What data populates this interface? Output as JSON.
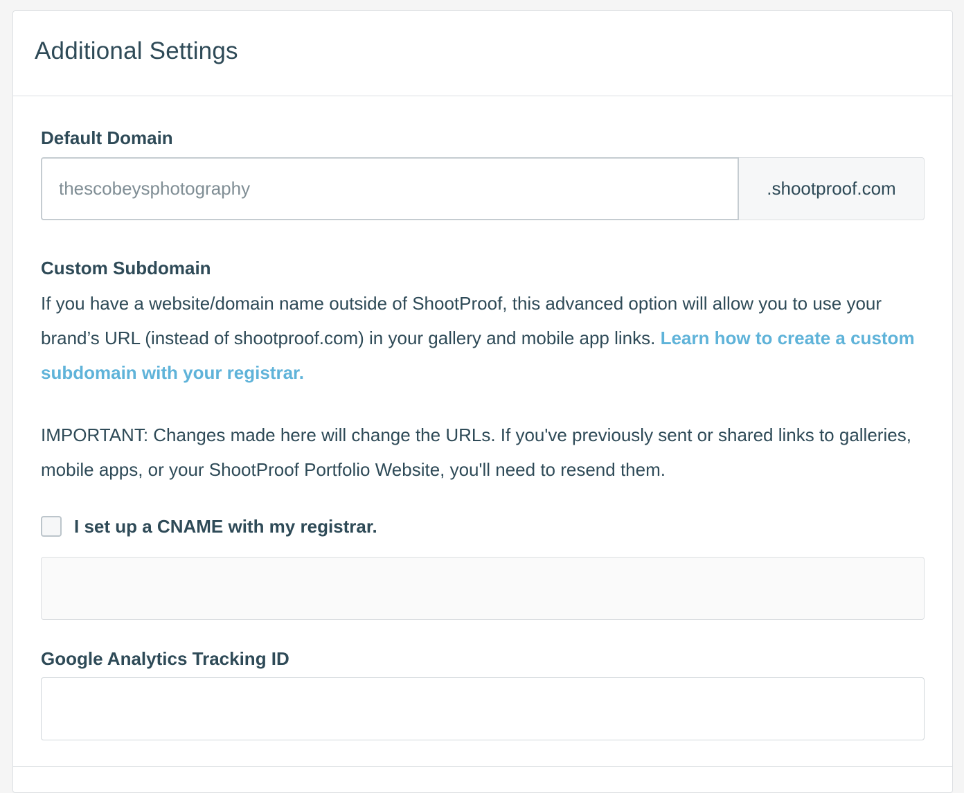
{
  "panel": {
    "title": "Additional Settings"
  },
  "default_domain": {
    "label": "Default Domain",
    "placeholder": "thescobeysphotography",
    "suffix": ".shootproof.com"
  },
  "custom_subdomain": {
    "label": "Custom Subdomain",
    "description": "If you have a website/domain name outside of ShootProof, this advanced option will allow you to use your brand’s URL (instead of shootproof.com) in your gallery and mobile app links. ",
    "learn_link": "Learn how to create a custom subdomain with your registrar.",
    "important": "IMPORTANT: Changes made here will change the URLs. If you've previously sent or shared links to galleries, mobile apps, or your ShootProof Portfolio Website, you'll need to resend them.",
    "cname_checkbox_label": "I set up a CNAME with my registrar.",
    "cname_checked": false,
    "subdomain_value": ""
  },
  "google_analytics": {
    "label": "Google Analytics Tracking ID",
    "value": ""
  },
  "colors": {
    "text": "#2e4a57",
    "link": "#5fb3d9",
    "border": "#dcdfe2",
    "addon_bg": "#f6f7f8"
  }
}
